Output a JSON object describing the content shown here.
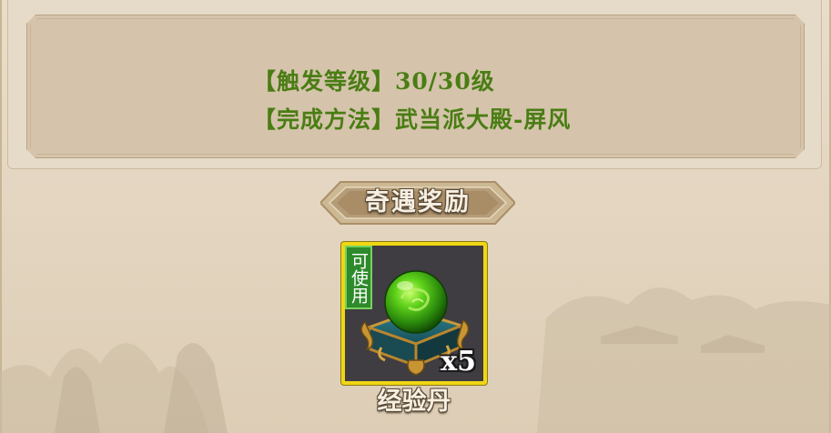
{
  "event": {
    "trigger_level": "【触发等级】30/30级",
    "completion_method": "【完成方法】武当派大殿-屏风"
  },
  "reward_section": {
    "title": "奇遇奖励"
  },
  "reward_item": {
    "usable_tag": "可使用",
    "quantity": "x5",
    "name": "经验丹",
    "icon": "green-pill-in-box-icon"
  },
  "colors": {
    "detail_text": "#4a7d14",
    "slot_border": "#f0d613",
    "usable_tag_bg": "#2f8a2c"
  }
}
